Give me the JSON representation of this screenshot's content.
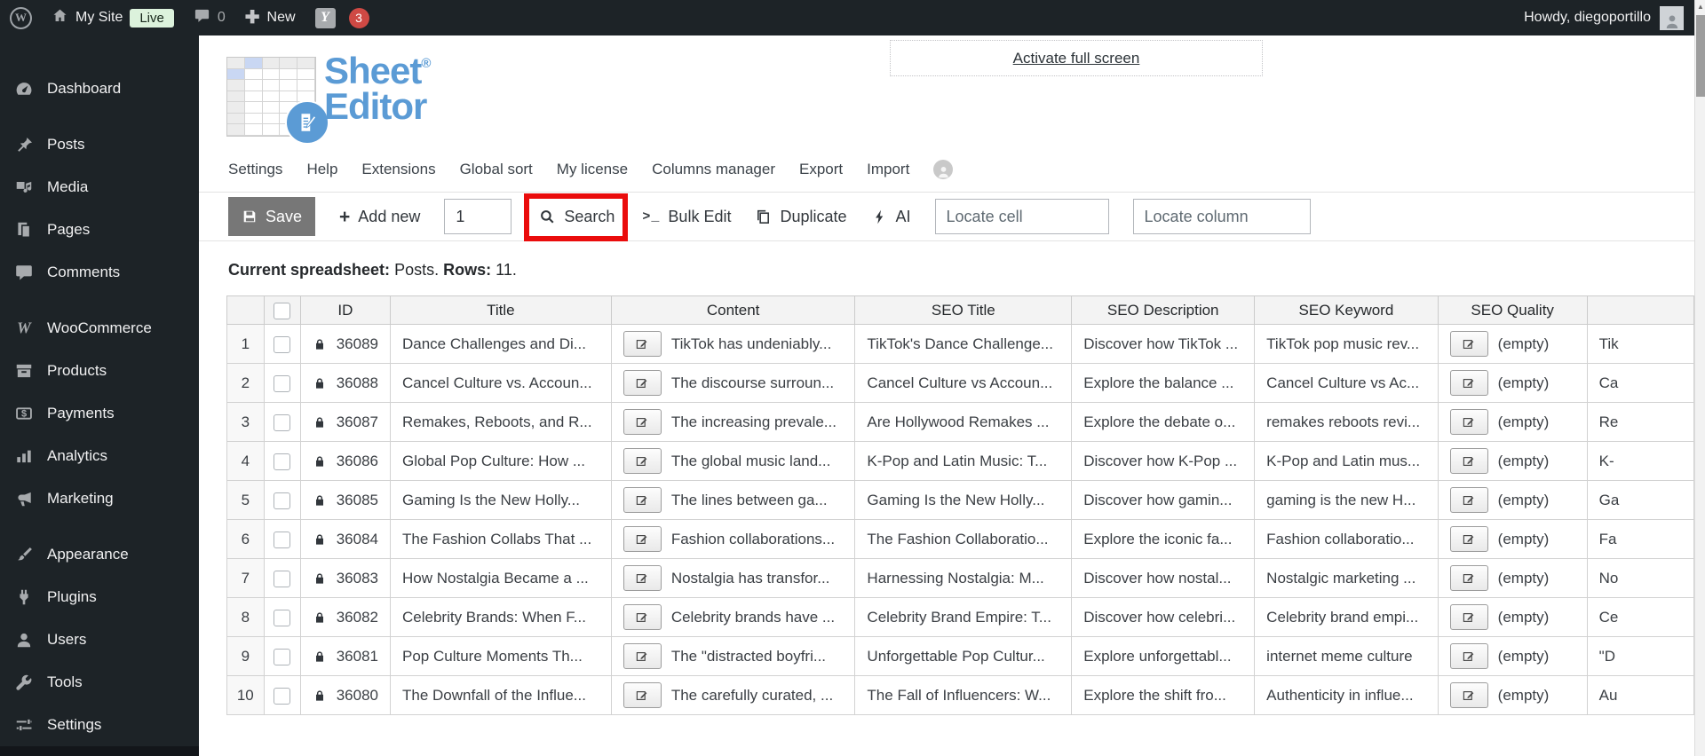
{
  "topbar": {
    "site_name": "My Site",
    "live_badge": "Live",
    "comments_count": "0",
    "new_label": "New",
    "yoast_letter": "Y",
    "yoast_badge": "3",
    "howdy": "Howdy, diegoportillo"
  },
  "sidebar": {
    "items": [
      {
        "label": "Dashboard",
        "icon": "dashboard-icon",
        "gap_before": false
      },
      {
        "label": "Posts",
        "icon": "posts-icon",
        "gap_before": true
      },
      {
        "label": "Media",
        "icon": "media-icon",
        "gap_before": false
      },
      {
        "label": "Pages",
        "icon": "pages-icon",
        "gap_before": false
      },
      {
        "label": "Comments",
        "icon": "comments-icon",
        "gap_before": false
      },
      {
        "label": "WooCommerce",
        "icon": "woocommerce-icon",
        "gap_before": true
      },
      {
        "label": "Products",
        "icon": "products-icon",
        "gap_before": false
      },
      {
        "label": "Payments",
        "icon": "payments-icon",
        "gap_before": false
      },
      {
        "label": "Analytics",
        "icon": "analytics-icon",
        "gap_before": false
      },
      {
        "label": "Marketing",
        "icon": "marketing-icon",
        "gap_before": false
      },
      {
        "label": "Appearance",
        "icon": "appearance-icon",
        "gap_before": true
      },
      {
        "label": "Plugins",
        "icon": "plugins-icon",
        "gap_before": false
      },
      {
        "label": "Users",
        "icon": "users-icon",
        "gap_before": false
      },
      {
        "label": "Tools",
        "icon": "tools-icon",
        "gap_before": false
      },
      {
        "label": "Settings",
        "icon": "settings-icon",
        "gap_before": false
      }
    ]
  },
  "fullscreen_link": "Activate full screen",
  "logo": {
    "line1": "Sheet",
    "reg": "®",
    "line2": "Editor"
  },
  "plugin_tabs": [
    "Settings",
    "Help",
    "Extensions",
    "Global sort",
    "My license",
    "Columns manager",
    "Export",
    "Import"
  ],
  "toolbar": {
    "save": "Save",
    "add_new": "Add new",
    "rows_input_value": "1",
    "search": "Search",
    "bulk_edit": "Bulk Edit",
    "duplicate": "Duplicate",
    "ai": "AI",
    "locate_cell_placeholder": "Locate cell",
    "locate_column_placeholder": "Locate column"
  },
  "status_line": {
    "prefix_label": "Current spreadsheet:",
    "spreadsheet": "Posts.",
    "rows_label": "Rows:",
    "rows_value": "11."
  },
  "table": {
    "headers": [
      "ID",
      "Title",
      "Content",
      "SEO Title",
      "SEO Description",
      "SEO Keyword",
      "SEO Quality"
    ],
    "rows": [
      {
        "num": "1",
        "id": "36089",
        "title": "Dance Challenges and Di...",
        "content": "TikTok has undeniably...",
        "seo_title": "TikTok's Dance Challenge...",
        "seo_description": "Discover how TikTok ...",
        "seo_keyword": "TikTok pop music rev...",
        "seo_quality": "(empty)",
        "extra": "Tik"
      },
      {
        "num": "2",
        "id": "36088",
        "title": "Cancel Culture vs. Accoun...",
        "content": "The discourse surroun...",
        "seo_title": "Cancel Culture vs Accoun...",
        "seo_description": "Explore the balance ...",
        "seo_keyword": "Cancel Culture vs Ac...",
        "seo_quality": "(empty)",
        "extra": "Ca"
      },
      {
        "num": "3",
        "id": "36087",
        "title": "Remakes, Reboots, and R...",
        "content": "The increasing prevale...",
        "seo_title": "Are Hollywood Remakes ...",
        "seo_description": "Explore the debate o...",
        "seo_keyword": "remakes reboots revi...",
        "seo_quality": "(empty)",
        "extra": "Re"
      },
      {
        "num": "4",
        "id": "36086",
        "title": "Global Pop Culture: How ...",
        "content": "The global music land...",
        "seo_title": "K-Pop and Latin Music: T...",
        "seo_description": "Discover how K-Pop ...",
        "seo_keyword": "K-Pop and Latin mus...",
        "seo_quality": "(empty)",
        "extra": "K-"
      },
      {
        "num": "5",
        "id": "36085",
        "title": "Gaming Is the New Holly...",
        "content": "The lines between ga...",
        "seo_title": "Gaming Is the New Holly...",
        "seo_description": "Discover how gamin...",
        "seo_keyword": "gaming is the new H...",
        "seo_quality": "(empty)",
        "extra": "Ga"
      },
      {
        "num": "6",
        "id": "36084",
        "title": "The Fashion Collabs That ...",
        "content": "Fashion collaborations...",
        "seo_title": "The Fashion Collaboratio...",
        "seo_description": "Explore the iconic fa...",
        "seo_keyword": "Fashion collaboratio...",
        "seo_quality": "(empty)",
        "extra": "Fa"
      },
      {
        "num": "7",
        "id": "36083",
        "title": "How Nostalgia Became a ...",
        "content": "Nostalgia has transfor...",
        "seo_title": "Harnessing Nostalgia: M...",
        "seo_description": "Discover how nostal...",
        "seo_keyword": "Nostalgic marketing ...",
        "seo_quality": "(empty)",
        "extra": "No"
      },
      {
        "num": "8",
        "id": "36082",
        "title": "Celebrity Brands: When F...",
        "content": "Celebrity brands have ...",
        "seo_title": "Celebrity Brand Empire: T...",
        "seo_description": "Discover how celebri...",
        "seo_keyword": "Celebrity brand empi...",
        "seo_quality": "(empty)",
        "extra": "Ce"
      },
      {
        "num": "9",
        "id": "36081",
        "title": "Pop Culture Moments Th...",
        "content": "The \"distracted boyfri...",
        "seo_title": "Unforgettable Pop Cultur...",
        "seo_description": "Explore unforgettabl...",
        "seo_keyword": "internet meme culture",
        "seo_quality": "(empty)",
        "extra": "\"D"
      },
      {
        "num": "10",
        "id": "36080",
        "title": "The Downfall of the Influe...",
        "content": "The carefully curated, ...",
        "seo_title": "The Fall of Influencers: W...",
        "seo_description": "Explore the shift fro...",
        "seo_keyword": "Authenticity in influe...",
        "seo_quality": "(empty)",
        "extra": "Au"
      }
    ]
  },
  "colors": {
    "admin_dark": "#1d2327",
    "brand_blue": "#5b9bd5",
    "highlight_red": "#ea0c0c",
    "notification_red": "#cf4944",
    "live_green": "#dcf2dc",
    "save_button_gray": "#777777"
  }
}
